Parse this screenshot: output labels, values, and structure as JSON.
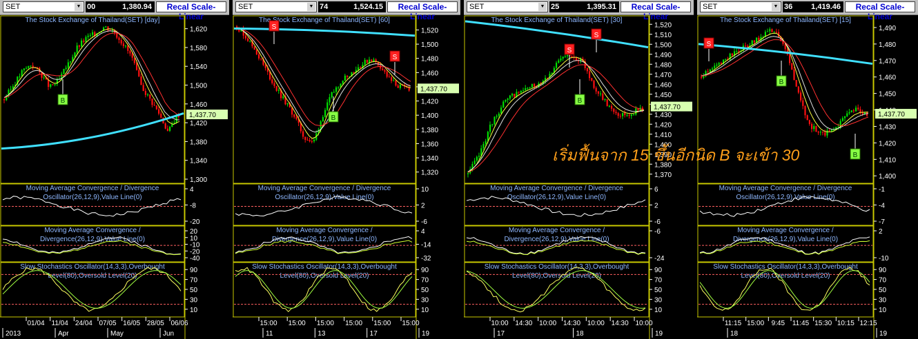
{
  "overlay_text": "เริ่มฟื้นจาก 15 ขึ้นอีกนิด B จะเข้า 30",
  "panels": [
    {
      "symbol": "SET",
      "price_a": "00",
      "price_b": "1,380.94",
      "scale_btn": "Recal Scale-Linear",
      "price_title": "The Stock Exchange of Thailand(SET) [day]",
      "y_ticks": [
        "1,620",
        "1,580",
        "1,540",
        "1,500",
        "1,460",
        "1,420",
        "1,380",
        "1,340",
        "1,300"
      ],
      "last_price": "1,437.70",
      "macd1_title": [
        "Moving Average Convergence / Divergence",
        "Oscillator(26,12,9),Value Line(0)"
      ],
      "macd1_ticks": [
        "4",
        "-8",
        "-20"
      ],
      "macd2_title": [
        "Moving Average Convergence /",
        "Divergence(26,12,9),Value Line(0)"
      ],
      "macd2_ticks": [
        "20",
        "10",
        "-10",
        "-20",
        "-40"
      ],
      "stoch_title": [
        "Slow Stochastics Oscillator(14,3,3),Overbought",
        "Level(80),Oversold Level(20)"
      ],
      "stoch_ticks": [
        "90",
        "70",
        "50",
        "30",
        "10"
      ],
      "x_labels_top": [
        "01/04",
        "11/04",
        "24/04",
        "07/05",
        "16/05",
        "28/05",
        "06/06"
      ],
      "x_labels_bottom": [
        "2013",
        "Apr",
        "May",
        "Jun"
      ],
      "signals": [
        "B"
      ]
    },
    {
      "symbol": "SET",
      "price_a": "74",
      "price_b": "1,524.15",
      "scale_btn": "Recal Scale-Linear",
      "price_title": "The Stock Exchange of Thailand(SET) [60]",
      "y_ticks": [
        "1,520",
        "1,500",
        "1,480",
        "1,460",
        "1,440",
        "1,420",
        "1,400",
        "1,380",
        "1,360",
        "1,340",
        "1,320"
      ],
      "last_price": "1,437.70",
      "macd1_title": [
        "Moving Average Convergence / Divergence",
        "Oscillator(26,12,9),Value Line(0)"
      ],
      "macd1_ticks": [
        "10",
        "2",
        "-6"
      ],
      "macd2_title": [
        "Moving Average Convergence /",
        "Divergence(26,12,9),Value Line(0)"
      ],
      "macd2_ticks": [
        "4",
        "-14",
        "-32"
      ],
      "stoch_title": [
        "Slow Stochastics Oscillator(14,3,3),Overbought",
        "Level(80),Oversold Level(20)"
      ],
      "stoch_ticks": [
        "90",
        "70",
        "50",
        "30",
        "10"
      ],
      "x_labels_top": [
        "15:00",
        "15:00",
        "15:00",
        "15:00",
        "15:00",
        "15:00"
      ],
      "x_labels_bottom": [
        "11",
        "13",
        "17",
        "19"
      ],
      "signals": [
        "S",
        "S",
        "B"
      ]
    },
    {
      "symbol": "SET",
      "price_a": "25",
      "price_b": "1,395.31",
      "scale_btn": "Recal Scale-Linear",
      "price_title": "The Stock Exchange of Thailand(SET) [30]",
      "y_ticks": [
        "1,520",
        "1,510",
        "1,500",
        "1,490",
        "1,480",
        "1,470",
        "1,460",
        "1,450",
        "1,440",
        "1,430",
        "1,420",
        "1,410",
        "1,400",
        "1,390",
        "1,380",
        "1,370"
      ],
      "last_price": "1,437.70",
      "macd1_title": [
        "Moving Average Convergence / Divergence",
        "Oscillator(26,12,9),Value Line(0)"
      ],
      "macd1_ticks": [
        "6",
        "2",
        "-6"
      ],
      "macd2_title": [
        "Moving Average Convergence /",
        "Divergence(26,12,9),Value Line(0)"
      ],
      "macd2_ticks": [
        "-6",
        "-24"
      ],
      "stoch_title": [
        "Slow Stochastics Oscillator(14,3,3),Overbought",
        "Level(80),Oversold Level(20)"
      ],
      "stoch_ticks": [
        "90",
        "70",
        "50",
        "30",
        "10"
      ],
      "x_labels_top": [
        "10:00",
        "14:30",
        "10:00",
        "14:30",
        "10:00",
        "14:30",
        "10:00"
      ],
      "x_labels_bottom": [
        "17",
        "18",
        "19"
      ],
      "signals": [
        "S",
        "S",
        "B"
      ]
    },
    {
      "symbol": "SET",
      "price_a": "36",
      "price_b": "1,419.46",
      "scale_btn": "Recal Scale-Linear",
      "price_title": "The Stock Exchange of Thailand(SET) [15]",
      "y_ticks": [
        "1,490",
        "1,480",
        "1,470",
        "1,460",
        "1,450",
        "1,440",
        "1,430",
        "1,420",
        "1,410",
        "1,400"
      ],
      "last_price": "1,437.70",
      "macd1_title": [
        "Moving Average Convergence / Divergence",
        "Oscillator(26,12,9),Value Line(0)"
      ],
      "macd1_ticks": [
        "-1",
        "-4",
        "-7"
      ],
      "macd2_title": [
        "Moving Average Convergence /",
        "Divergence(26,12,9),Value Line(0)"
      ],
      "macd2_ticks": [
        "2",
        "-10"
      ],
      "stoch_title": [
        "Slow Stochastics Oscillator(14,3,3),Overbought",
        "Level(80),Oversold Level(20)"
      ],
      "stoch_ticks": [
        "90",
        "70",
        "50",
        "30",
        "10"
      ],
      "x_labels_top": [
        "11:15",
        "15:00",
        "9:45",
        "11:45",
        "15:30",
        "10:15",
        "12:15"
      ],
      "x_labels_bottom": [
        "18",
        "19"
      ],
      "signals": [
        "S",
        "B",
        "B"
      ]
    }
  ],
  "chart_data": [
    {
      "type": "line",
      "title": "The Stock Exchange of Thailand(SET) [day]",
      "ylim": [
        1300,
        1640
      ],
      "series": [
        {
          "values": [
            1470,
            1500,
            1530,
            1545,
            1525,
            1495,
            1510,
            1545,
            1580,
            1600,
            1610,
            1625,
            1615,
            1590,
            1560,
            1500,
            1470,
            1440,
            1400,
            1437.7
          ]
        }
      ]
    },
    {
      "type": "line",
      "title": "The Stock Exchange of Thailand(SET) [60]",
      "ylim": [
        1310,
        1535
      ],
      "series": [
        {
          "values": [
            1525,
            1510,
            1490,
            1465,
            1440,
            1420,
            1400,
            1370,
            1360,
            1400,
            1430,
            1450,
            1460,
            1470,
            1480,
            1470,
            1450,
            1440,
            1437.7
          ]
        }
      ]
    },
    {
      "type": "line",
      "title": "The Stock Exchange of Thailand(SET) [30]",
      "ylim": [
        1365,
        1525
      ],
      "series": [
        {
          "values": [
            1370,
            1390,
            1420,
            1440,
            1450,
            1455,
            1460,
            1470,
            1485,
            1490,
            1480,
            1455,
            1440,
            1430,
            1430,
            1437.7
          ]
        }
      ]
    },
    {
      "type": "line",
      "title": "The Stock Exchange of Thailand(SET) [15]",
      "ylim": [
        1398,
        1495
      ],
      "series": [
        {
          "values": [
            1460,
            1465,
            1470,
            1475,
            1478,
            1482,
            1488,
            1486,
            1470,
            1445,
            1430,
            1425,
            1428,
            1435,
            1440,
            1437.7
          ]
        }
      ]
    }
  ]
}
